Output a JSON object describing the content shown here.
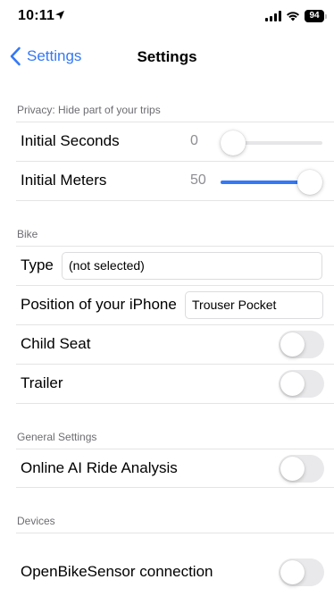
{
  "status_bar": {
    "time": "10:11",
    "battery": "94",
    "icons": [
      "location-arrow-icon",
      "cellular-signal-icon",
      "wifi-icon",
      "battery-icon"
    ]
  },
  "nav": {
    "back_label": "Settings",
    "title": "Settings"
  },
  "privacy": {
    "header": "Privacy: Hide part of your trips",
    "initial_seconds": {
      "label": "Initial Seconds",
      "value": "0",
      "fraction": 0.0
    },
    "initial_meters": {
      "label": "Initial Meters",
      "value": "50",
      "fraction": 1.0
    }
  },
  "bike": {
    "header": "Bike",
    "type": {
      "label": "Type",
      "value": "(not selected)"
    },
    "position": {
      "label": "Position of your iPhone",
      "value": "Trouser Pocket"
    },
    "child_seat": {
      "label": "Child Seat",
      "on": false
    },
    "trailer": {
      "label": "Trailer",
      "on": false
    }
  },
  "general": {
    "header": "General Settings",
    "online_ai": {
      "label": "Online AI Ride Analysis",
      "on": false
    }
  },
  "devices": {
    "header": "Devices",
    "obs": {
      "label": "OpenBikeSensor connection",
      "on": false
    }
  },
  "colors": {
    "accent": "#3478f6",
    "toggle_off": "#e9e9eb",
    "secondary_text": "#6d6d72"
  }
}
